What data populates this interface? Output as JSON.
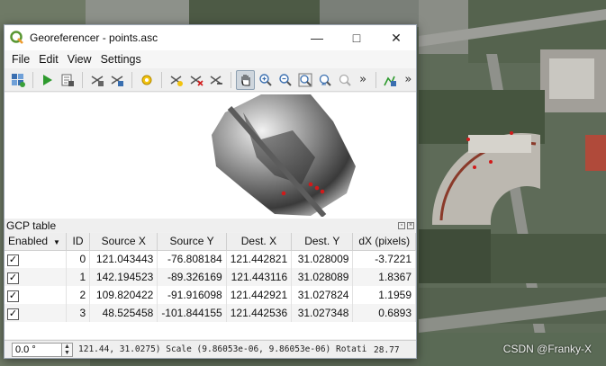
{
  "window": {
    "title": "Georeferencer - points.asc",
    "app_icon": "qgis-logo-icon"
  },
  "menubar": {
    "items": [
      "File",
      "Edit",
      "View",
      "Settings"
    ]
  },
  "toolbar": {
    "buttons": [
      "open-raster-icon",
      "start-georeferencing-icon",
      "generate-gdal-script-icon",
      "load-gcp-points-icon",
      "save-gcp-points-icon",
      "transformation-settings-icon",
      "add-point-icon",
      "delete-point-icon",
      "move-gcp-point-icon",
      "pan-icon",
      "zoom-in-icon",
      "zoom-out-icon",
      "zoom-to-layer-icon",
      "zoom-last-icon",
      "zoom-next-icon",
      "link-georeferencer-icon"
    ],
    "overflow": "»",
    "active": "pan-icon"
  },
  "gcp_table": {
    "title": "GCP table",
    "columns": [
      "Enabled",
      "ID",
      "Source X",
      "Source Y",
      "Dest. X",
      "Dest. Y",
      "dX (pixels)"
    ],
    "rows": [
      {
        "enabled": true,
        "id": "0",
        "source_x": "121.043443",
        "source_y": "-76.808184",
        "dest_x": "121.442821",
        "dest_y": "31.028009",
        "dx": "-3.7221"
      },
      {
        "enabled": true,
        "id": "1",
        "source_x": "142.194523",
        "source_y": "-89.326169",
        "dest_x": "121.443116",
        "dest_y": "31.028089",
        "dx": "1.8367"
      },
      {
        "enabled": true,
        "id": "2",
        "source_x": "109.820422",
        "source_y": "-91.916098",
        "dest_x": "121.442921",
        "dest_y": "31.027824",
        "dx": "1.1959"
      },
      {
        "enabled": true,
        "id": "3",
        "source_x": "48.525458",
        "source_y": "-101.844155",
        "dest_x": "121.442536",
        "dest_y": "31.027348",
        "dx": "0.6893"
      }
    ]
  },
  "statusbar": {
    "rotation_value": "0.0 °",
    "coordinates_text": "121.44, 31.0275) Scale (9.86053e-06, 9.86053e-06) Rotati",
    "extra_value": "28.77"
  },
  "watermark": "CSDN @Franky-X",
  "colors": {
    "gcp_marker": "#d11a1a",
    "active_tool_bg": "#cfd6dd"
  }
}
